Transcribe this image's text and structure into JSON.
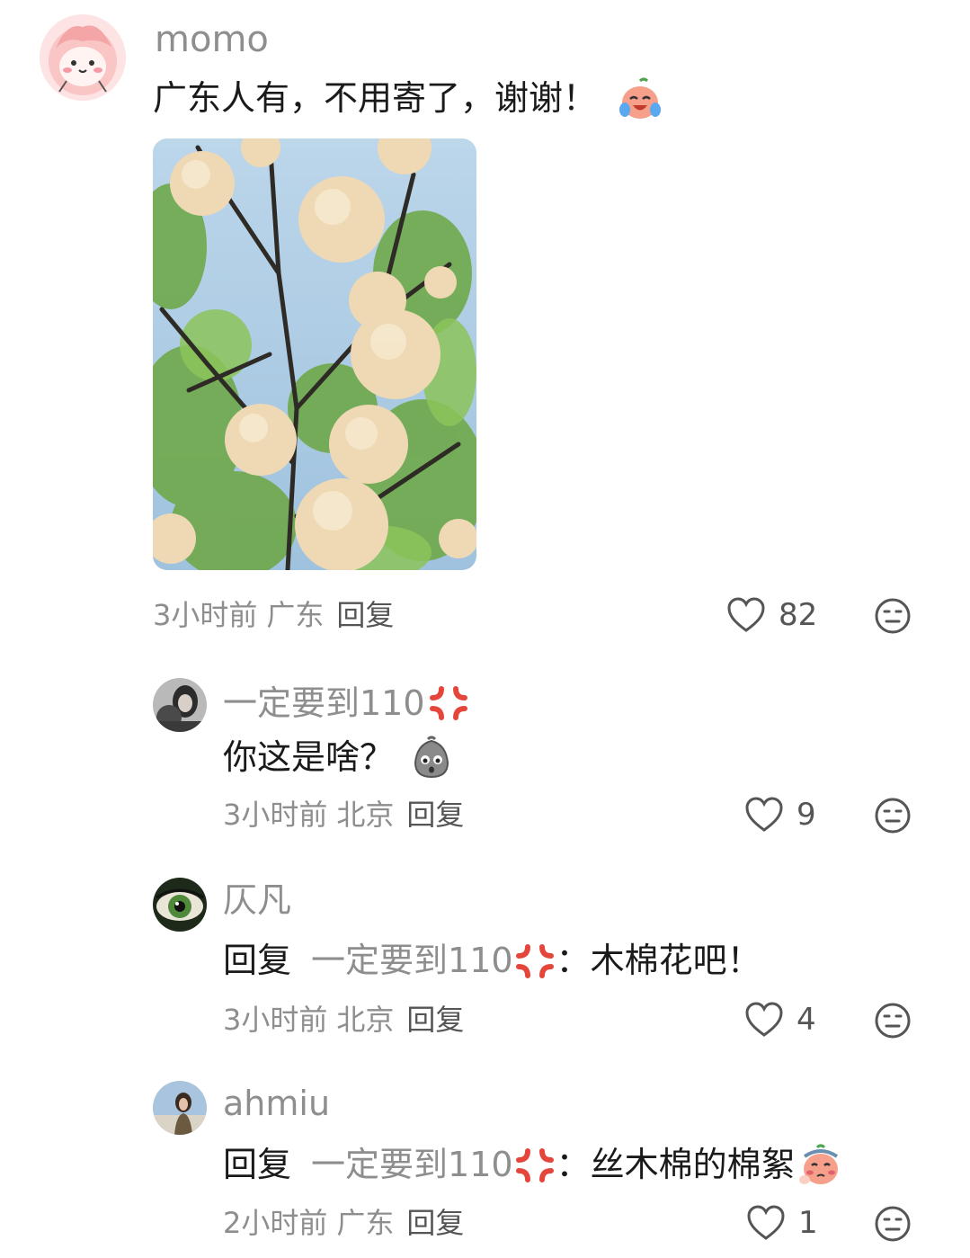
{
  "comments": [
    {
      "username": "momo",
      "text": "广东人有，不用寄了，谢谢！",
      "emoji": "crying-laugh-emoji",
      "time": "3小时前",
      "location": "广东",
      "reply_label": "回复",
      "likes": "82"
    },
    {
      "username": "一定要到110",
      "username_badge": "anger-symbol-emoji",
      "text": "你这是啥？",
      "emoji": "confused-face-emoji",
      "time": "3小时前",
      "location": "北京",
      "reply_label": "回复",
      "likes": "9"
    },
    {
      "username": "仄凡",
      "reply_prefix": "回复",
      "reply_target": "一定要到110",
      "separator": "：",
      "text": "木棉花吧！",
      "time": "3小时前",
      "location": "北京",
      "reply_label": "回复",
      "likes": "4"
    },
    {
      "username": "ahmiu",
      "reply_prefix": "回复",
      "reply_target": "一定要到110",
      "separator": "：",
      "text": "丝木棉的棉絮",
      "emoji": "shy-face-emoji",
      "time": "2小时前",
      "location": "广东",
      "reply_label": "回复",
      "likes": "1"
    }
  ],
  "colors": {
    "username": "#8e8e8e",
    "text": "#1a1a1a",
    "meta": "#8e8e8e",
    "anger": "#e5463c"
  },
  "icons": {
    "like": "heart-outline-icon",
    "dislike": "meh-face-icon"
  }
}
